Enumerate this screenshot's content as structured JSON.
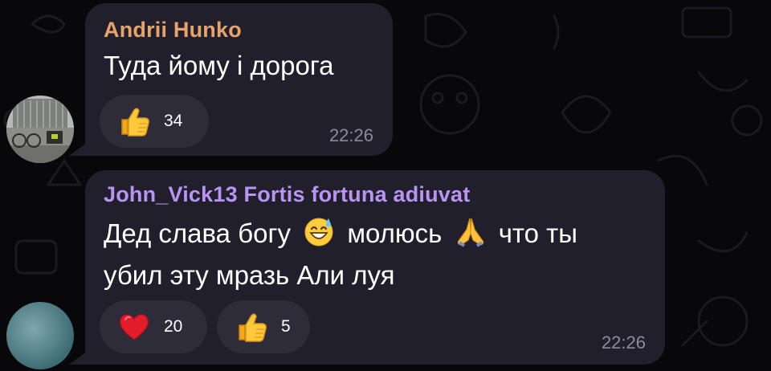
{
  "messages": [
    {
      "sender": "Andrii Hunko",
      "text": "Туда йому і дорога",
      "time": "22:26",
      "reactions": [
        {
          "icon": "thumbs-up-icon",
          "count": "34"
        }
      ]
    },
    {
      "sender": "John_Vick13 Fortis fortuna adiuvat",
      "text_line1_a": "Дед слава богу",
      "text_line1_b": "молюсь",
      "text_line1_c": "что ты",
      "text_line2": "убил эту мразь Али луя",
      "inline_emojis": [
        "grinning-sweat-emoji",
        "folded-hands-emoji"
      ],
      "time": "22:26",
      "reactions": [
        {
          "icon": "red-heart-icon",
          "count": "20"
        },
        {
          "icon": "thumbs-up-icon",
          "count": "5"
        }
      ]
    }
  ],
  "colors": {
    "background": "#08080b",
    "bubble": "#211f2b",
    "reaction_pill": "#2f2c3a",
    "sender_1": "#e8a36b",
    "sender_2": "#b994f2",
    "timestamp": "#8d8a9b"
  }
}
